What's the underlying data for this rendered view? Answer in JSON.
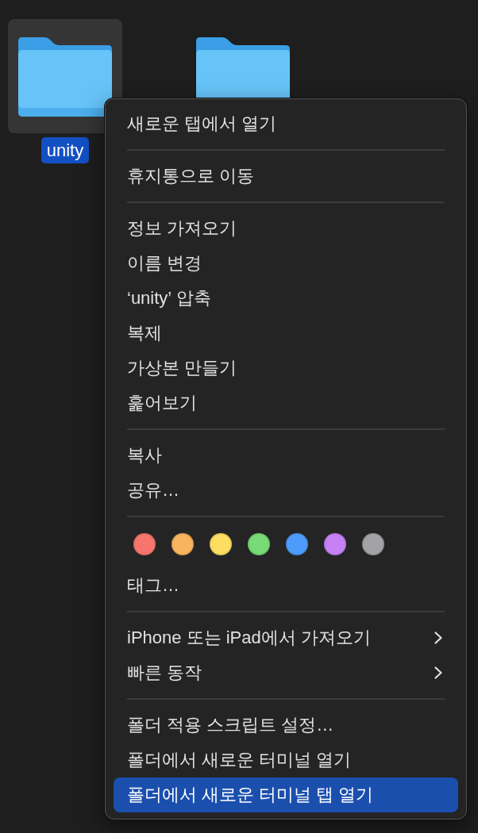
{
  "desktop": {
    "folders": [
      {
        "name": "unity",
        "selected": true
      },
      {
        "selected": false
      }
    ]
  },
  "context_menu": {
    "sections": [
      {
        "items": [
          {
            "kind": "item",
            "label": "새로운 탭에서 열기",
            "selected": false
          }
        ]
      },
      {
        "items": [
          {
            "kind": "item",
            "label": "휴지통으로 이동",
            "selected": false
          }
        ]
      },
      {
        "items": [
          {
            "kind": "item",
            "label": "정보 가져오기",
            "selected": false
          },
          {
            "kind": "item",
            "label": "이름 변경",
            "selected": false
          },
          {
            "kind": "item",
            "label": "‘unity’ 압축",
            "selected": false
          },
          {
            "kind": "item",
            "label": "복제",
            "selected": false
          },
          {
            "kind": "item",
            "label": "가상본 만들기",
            "selected": false
          },
          {
            "kind": "item",
            "label": "훑어보기",
            "selected": false
          }
        ]
      },
      {
        "items": [
          {
            "kind": "item",
            "label": "복사",
            "selected": false
          },
          {
            "kind": "item",
            "label": "공유…",
            "selected": false
          }
        ]
      },
      {
        "items": [
          {
            "kind": "tags",
            "tags": [
              {
                "color": "#f7756d"
              },
              {
                "color": "#f8b45e"
              },
              {
                "color": "#fddd62"
              },
              {
                "color": "#77da76"
              },
              {
                "color": "#4d9cfb"
              },
              {
                "color": "#c682f5"
              },
              {
                "color": "#a3a3a7"
              }
            ]
          },
          {
            "kind": "item",
            "label": "태그…",
            "selected": false
          }
        ]
      },
      {
        "items": [
          {
            "kind": "submenu",
            "label": "iPhone 또는 iPad에서 가져오기",
            "selected": false
          },
          {
            "kind": "submenu",
            "label": "빠른 동작",
            "selected": false
          }
        ]
      },
      {
        "items": [
          {
            "kind": "item",
            "label": "폴더 적용 스크립트 설정…",
            "selected": false
          },
          {
            "kind": "item",
            "label": "폴더에서 새로운 터미널 열기",
            "selected": false
          },
          {
            "kind": "item",
            "label": "폴더에서 새로운 터미널 탭 열기",
            "selected": true
          }
        ]
      }
    ]
  }
}
